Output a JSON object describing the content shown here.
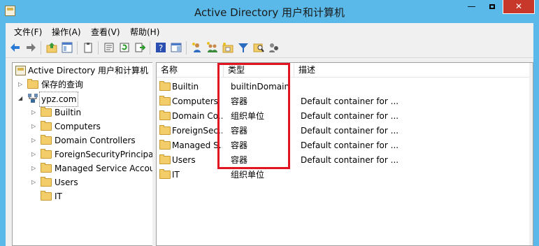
{
  "window": {
    "title": "Active Directory 用户和计算机",
    "controls": {
      "minimize": "—",
      "close": "✕"
    }
  },
  "menu": [
    "文件(F)",
    "操作(A)",
    "查看(V)",
    "帮助(H)"
  ],
  "toolbar": {
    "buttons": [
      "back-icon",
      "forward-icon",
      "up-folder-icon",
      "show-tree-icon",
      "clipboard-icon",
      "properties-icon",
      "refresh-icon",
      "export-list-icon",
      "help-icon",
      "action-pane-icon",
      "add-user-icon",
      "add-group-icon",
      "new-ou-icon",
      "filter-icon",
      "find-icon",
      "delegate-icon"
    ]
  },
  "tree": {
    "root": "Active Directory 用户和计算机",
    "saved_queries": "保存的查询",
    "domain": "ypz.com",
    "children": [
      "Builtin",
      "Computers",
      "Domain Controllers",
      "ForeignSecurityPrincipals",
      "Managed Service Accounts",
      "Users",
      "IT"
    ]
  },
  "list": {
    "columns": [
      "名称",
      "类型",
      "描述"
    ],
    "rows": [
      {
        "name": "Builtin",
        "type": "builtinDomain",
        "desc": ""
      },
      {
        "name": "Computers",
        "type": "容器",
        "desc": "Default container for ..."
      },
      {
        "name": "Domain Co...",
        "type": "组织单位",
        "desc": "Default container for ..."
      },
      {
        "name": "ForeignSec...",
        "type": "容器",
        "desc": "Default container for ..."
      },
      {
        "name": "Managed S...",
        "type": "容器",
        "desc": "Default container for ..."
      },
      {
        "name": "Users",
        "type": "容器",
        "desc": "Default container for ..."
      },
      {
        "name": "IT",
        "type": "组织单位",
        "desc": ""
      }
    ]
  },
  "colors": {
    "titlebar": "#5ab9e8",
    "close": "#c7382b",
    "highlight": "#e01422"
  }
}
